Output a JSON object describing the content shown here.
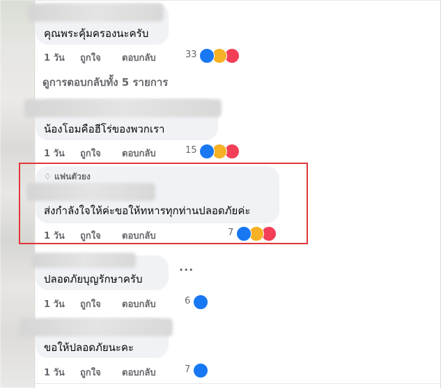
{
  "comments": [
    {
      "text": "คุณพระคุ้มครองนะครับ",
      "time": "1 วัน",
      "like_label": "ถูกใจ",
      "reply_label": "ตอบกลับ",
      "reaction_count": "33",
      "reactions": [
        "like-icon",
        "haha-icon",
        "love-icon"
      ]
    },
    {
      "text": "น้องโอมคือฮีโร่ของพวกเรา",
      "time": "1 วัน",
      "like_label": "ถูกใจ",
      "reply_label": "ตอบกลับ",
      "reaction_count": "15",
      "reactions": [
        "like-icon",
        "haha-icon",
        "love-icon"
      ]
    },
    {
      "badge": "แฟนตัวยง",
      "text": "ส่งกำลังใจให้ค่ะขอให้ทหารทุกท่านปลอดภัยค่ะ",
      "time": "1 วัน",
      "like_label": "ถูกใจ",
      "reply_label": "ตอบกลับ",
      "reaction_count": "7",
      "reactions": [
        "like-icon",
        "haha-icon",
        "love-icon"
      ]
    },
    {
      "text": "ปลอดภัยบุญรักษาครับ",
      "time": "1 วัน",
      "like_label": "ถูกใจ",
      "reply_label": "ตอบกลับ",
      "reaction_count": "6",
      "reactions": [
        "like-icon"
      ]
    },
    {
      "text": "ขอให้ปลอดภัยนะคะ",
      "time": "1 วัน",
      "like_label": "ถูกใจ",
      "reply_label": "ตอบกลับ",
      "reaction_count": "7",
      "reactions": [
        "like-icon"
      ]
    }
  ],
  "view_replies": "ดูการตอบกลับทั้ง 5 รายการ",
  "more_options": "...",
  "colors": {
    "bubble": "#f0f2f5",
    "secondary_text": "#65676b",
    "like": "#1877f2",
    "haha": "#f7b125",
    "love": "#f33e58",
    "highlight_border": "#e0373a"
  }
}
